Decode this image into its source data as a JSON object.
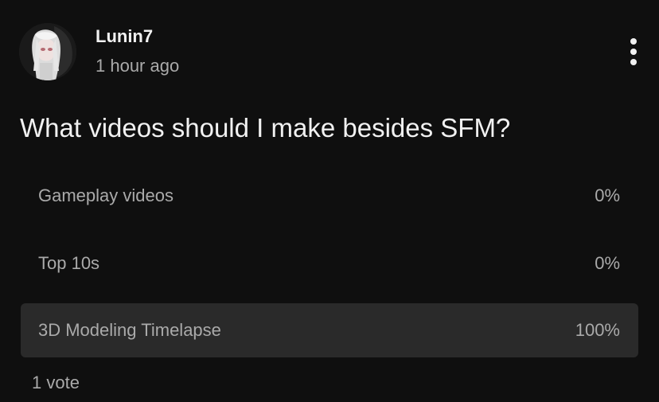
{
  "post": {
    "author": "Lunin7",
    "timestamp": "1 hour ago",
    "avatar_icon": "anime-character-avatar",
    "menu_icon": "vertical-ellipsis-icon"
  },
  "poll": {
    "question": "What videos should I make besides SFM?",
    "options": [
      {
        "label": "Gameplay videos",
        "percent_text": "0%",
        "percent": 0,
        "selected": false
      },
      {
        "label": "Top 10s",
        "percent_text": "0%",
        "percent": 0,
        "selected": false
      },
      {
        "label": "3D Modeling Timelapse",
        "percent_text": "100%",
        "percent": 100,
        "selected": true
      }
    ],
    "vote_count": "1 vote"
  },
  "colors": {
    "background": "#0f0f0f",
    "primary_text": "#f1f1f1",
    "secondary_text": "#aaaaaa",
    "highlight_option": "#2a2a2a"
  }
}
